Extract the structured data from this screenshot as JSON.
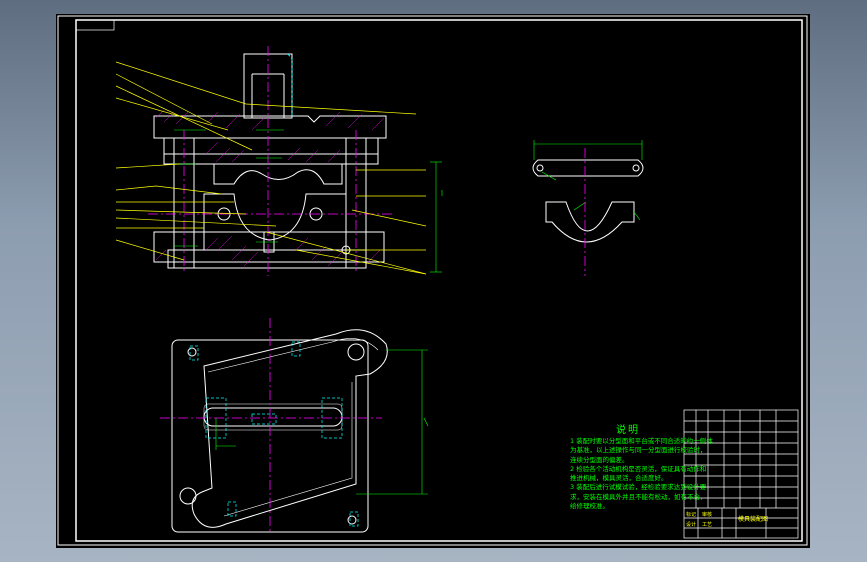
{
  "notes": {
    "title": "说明",
    "lines": [
      "1 装配时要以分型面和平台或不同合适的约一侧体",
      "为基准，以上述操作与同一分型面进行校验时，",
      "连续分型面的偏差。",
      "2 检验各个活动机构是否灵活，保证具有动作和",
      "推进机械，模具灵活，合适度好。",
      "3 装配后进行试模试验，经检验要求达到设计要",
      "求，安装在模具外并且不能有松动，如有不合，",
      "给修理校准。"
    ]
  },
  "title_block": {
    "drawing_name": "模具装配图",
    "row_labels": [
      "标记",
      "设计",
      "审核",
      "工艺"
    ]
  },
  "colors": {
    "background": "#000000",
    "frame": "#ffffff",
    "outline": "#ffffff",
    "dimension": "#00ff00",
    "leader": "#ffff00",
    "centerline": "#ff00ff",
    "hidden": "#00ffff",
    "hatch": "#ff00ff",
    "app_backdrop": "#8d9db0"
  }
}
